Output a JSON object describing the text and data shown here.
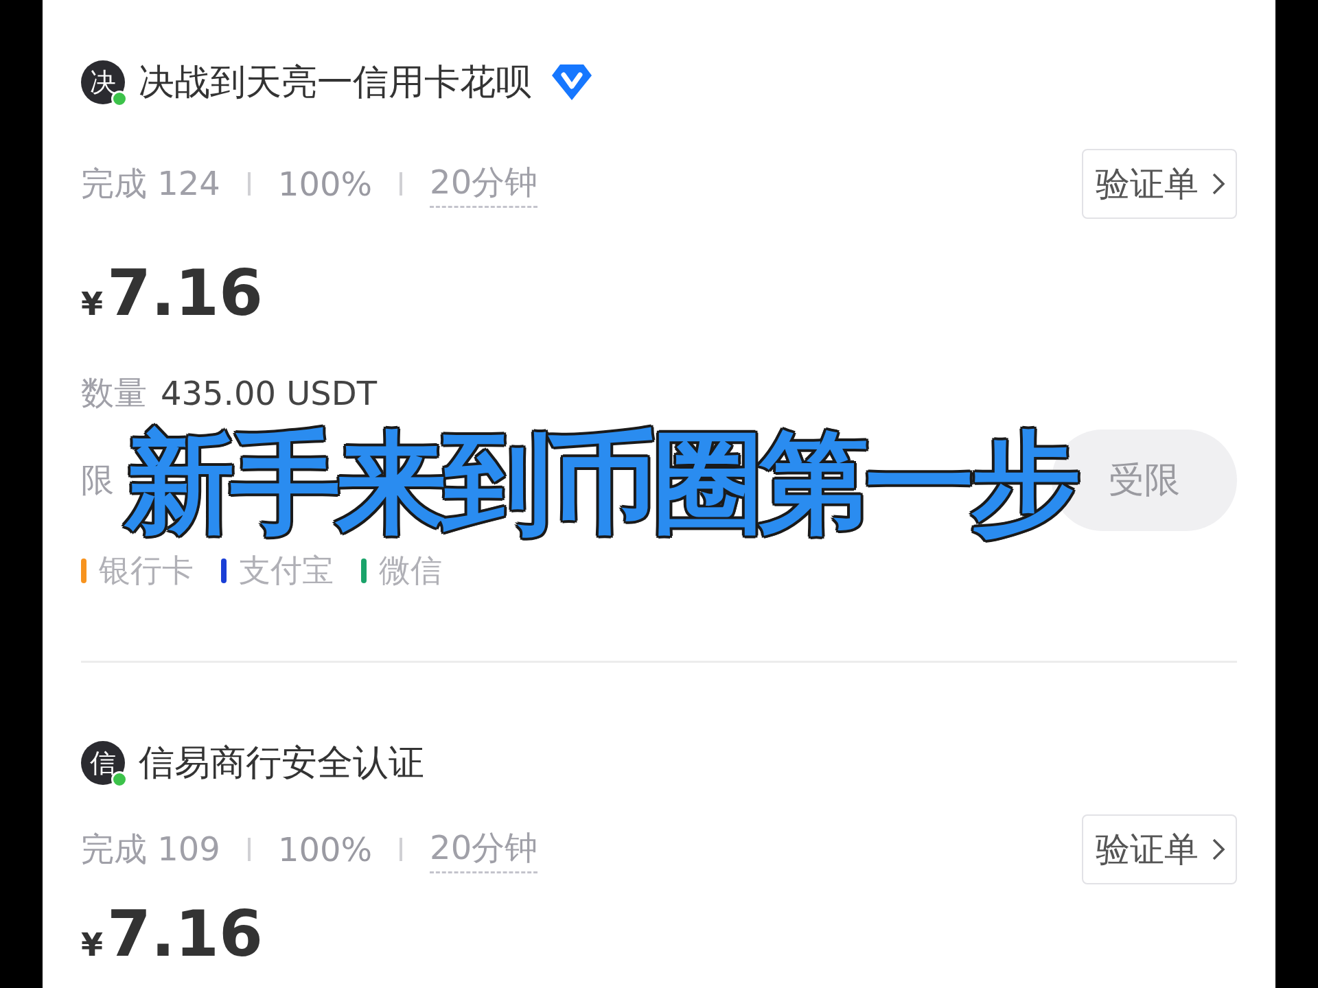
{
  "caption": "新手来到币圈第一步",
  "merchants": [
    {
      "avatar": "决",
      "online": true,
      "name": "决战到天亮一信用卡花呗",
      "verified": true,
      "completed_label": "完成",
      "completed": "124",
      "rate": "100%",
      "time": "20分钟",
      "verify_button": "验证单",
      "currency": "¥",
      "price": "7.16",
      "quantity_label": "数量",
      "quantity": "435.00 USDT",
      "limit_label": "限",
      "action_button": "受限",
      "payments": [
        {
          "label": "银行卡",
          "color": "#f7931e"
        },
        {
          "label": "支付宝",
          "color": "#1a3fd6"
        },
        {
          "label": "微信",
          "color": "#1aa36a"
        }
      ]
    },
    {
      "avatar": "信",
      "online": true,
      "name": "信易商行安全认证",
      "verified": false,
      "completed_label": "完成",
      "completed": "109",
      "rate": "100%",
      "time": "20分钟",
      "verify_button": "验证单",
      "currency": "¥",
      "price": "7.16"
    }
  ]
}
